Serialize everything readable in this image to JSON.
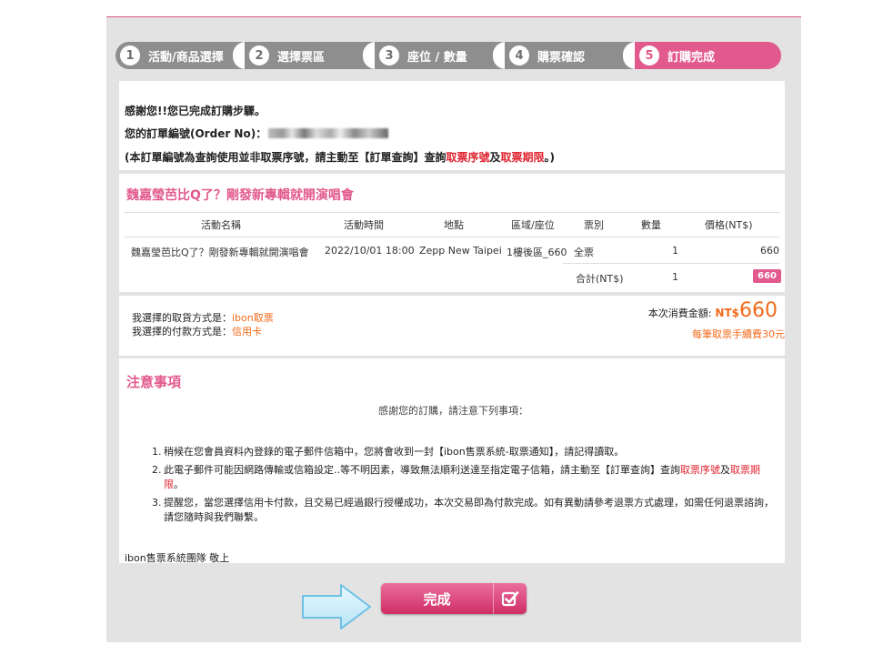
{
  "steps": [
    {
      "num": "1",
      "label": "活動/商品選擇"
    },
    {
      "num": "2",
      "label": "選擇票區"
    },
    {
      "num": "3",
      "label": "座位 / 數量"
    },
    {
      "num": "4",
      "label": "購票確認"
    },
    {
      "num": "5",
      "label": "訂購完成",
      "active": true
    }
  ],
  "confirmation": {
    "thanks": "感謝您!!您已完成訂購步驟。",
    "order_label": "您的訂單編號(Order No)：",
    "notice_prefix": "(本訂單編號為查詢使用並非取票序號，請主動至【訂單查詢】查詢",
    "notice_red1": "取票序號",
    "notice_mid": "及",
    "notice_red2": "取票期限",
    "notice_suffix": "。)"
  },
  "event": {
    "title": "魏嘉瑩芭比Q了？剛發新專輯就開演唱會",
    "headers": [
      "活動名稱",
      "活動時間",
      "地點",
      "區域/座位",
      "票別",
      "數量",
      "價格(NT$)"
    ],
    "row": {
      "name": "魏嘉瑩芭比Q了？剛發新專輯就開演唱會",
      "time": "2022/10/01 18:00",
      "venue": "Zepp New Taipei",
      "seat": "1樓後區_660",
      "ticket_type": "全票",
      "qty": "1",
      "price": "660"
    },
    "subtotal": {
      "label": "合計(NT$)",
      "qty": "1",
      "amount": "660"
    }
  },
  "payment": {
    "pickup_label": "我選擇的取貨方式是：",
    "pickup_value": "ibon取票",
    "pay_label": "我選擇的付款方式是：",
    "pay_value": "信用卡",
    "total_label": "本次消費金額:",
    "total_currency": "NT$",
    "total_value": "660",
    "fee_note": "每筆取票手續費30元"
  },
  "notes": {
    "title": "注意事項",
    "intro": "感謝您的訂購，請注意下列事項：",
    "item1": "稍候在您會員資料內登錄的電子郵件信箱中，您將會收到一封【ibon售票系統-取票通知】，請記得讀取。",
    "item2_prefix": "此電子郵件可能因網路傳輸或信箱設定..等不明因素，導致無法順利送達至指定電子信箱，請主動至【訂單查詢】查詢",
    "item2_red1": "取票序號",
    "item2_mid": "及",
    "item2_red2": "取票期限",
    "item2_suffix": "。",
    "item3": "提醒您，當您選擇信用卡付款，且交易已經過銀行授權成功，本次交易即為付款完成。如有異動請參考退票方式處理，如需任何退票諮詢，請您隨時與我們聯繫。",
    "signature": "ibon售票系統團隊 敬上"
  },
  "actions": {
    "done_label": "完成"
  },
  "colors": {
    "accent": "#e25a8d",
    "step_gray": "#8e8e8e",
    "highlight_red": "#e0232f",
    "orange": "#f26a1b",
    "frame": "#e3e3e3"
  },
  "icons": {
    "done": "checkbox-check-icon",
    "pointer": "right-arrow-icon"
  }
}
